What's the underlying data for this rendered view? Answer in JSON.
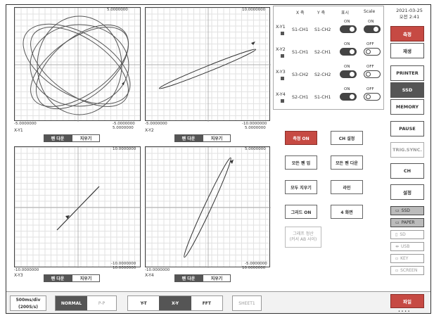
{
  "datetime": {
    "date": "2021-03-25",
    "time": "오전 2:41"
  },
  "plots": [
    {
      "name": "X-Y1",
      "top": "5.0000000",
      "bottom_left": "-5.0000000",
      "bottom_right_1": "-5.0000000",
      "bottom_right_2": "5.0000000",
      "pen": "펜 다운",
      "erase": "지우기"
    },
    {
      "name": "X-Y2",
      "top": "10.0000000",
      "bottom_left": "-5.0000000",
      "bottom_right_1": "-10.0000000",
      "bottom_right_2": "5.0000000",
      "pen": "펜 다운",
      "erase": "지우기"
    },
    {
      "name": "X-Y3",
      "top": "10.0000000",
      "bottom_left": "-10.0000000",
      "bottom_right_1": "-10.0000000",
      "bottom_right_2": "10.0000000",
      "pen": "펜 다운",
      "erase": "지우기"
    },
    {
      "name": "X-Y4",
      "top": "5.0000000",
      "bottom_left": "-10.0000000",
      "bottom_right_1": "-5.0000000",
      "bottom_right_2": "10.0000000",
      "pen": "펜 다운",
      "erase": "지우기"
    }
  ],
  "table": {
    "headers": [
      "X 축",
      "Y 축",
      "표시",
      "Scale"
    ],
    "rows": [
      {
        "id": "X-Y1",
        "x": "S1-CH1",
        "y": "S1-CH2",
        "show": "ON",
        "scale": "ON"
      },
      {
        "id": "X-Y2",
        "x": "S1-CH1",
        "y": "S2-CH1",
        "show": "ON",
        "scale": "OFF"
      },
      {
        "id": "X-Y3",
        "x": "S3-CH2",
        "y": "S2-CH2",
        "show": "ON",
        "scale": "OFF"
      },
      {
        "id": "X-Y4",
        "x": "S2-CH1",
        "y": "S1-CH1",
        "show": "ON",
        "scale": "OFF"
      }
    ]
  },
  "middle_buttons": {
    "measure_on": "측정 ON",
    "ch_settings": "CH 설정",
    "all_pen_up": "모든 펜 업",
    "all_pen_down": "모든 펜 다운",
    "erase_all": "모두 지우기",
    "line": "라인",
    "grid_on": "그리드 ON",
    "four_screen": "4 화면",
    "graph_calc_1": "그래프 정산",
    "graph_calc_2": "(커서 AB 사이)"
  },
  "right_buttons": {
    "measure": "측정",
    "play": "재생",
    "printer": "PRINTER",
    "ssd": "SSD",
    "memory": "MEMORY",
    "pause": "PAUSE",
    "trig_sync": "TRIG.SYNC.",
    "ch": "CH",
    "settings": "설정",
    "ssd_small": "SSD",
    "paper": "PAPER",
    "sd": "SD",
    "usb": "USB",
    "key": "KEY",
    "screen": "SCREEN",
    "file": "파일"
  },
  "bottom_bar": {
    "timebase_1": "500ms/div",
    "timebase_2": "(200S/s)",
    "normal": "NORMAL",
    "pp": "P-P",
    "yt": "Y-T",
    "xy": "X-Y",
    "fft": "FFT",
    "sheet": "SHEET1",
    "dots": "• • • •"
  },
  "colors": {
    "accent_red": "#c64a43",
    "dark": "#555555"
  }
}
